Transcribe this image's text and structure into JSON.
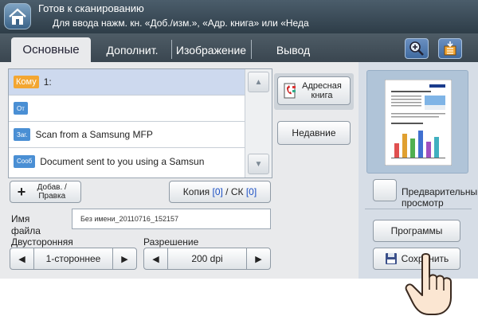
{
  "status": {
    "title": "Готов к сканированию",
    "message": "Для ввода нажм. кн. «Доб./изм.», «Адр. книга» или «Неда"
  },
  "tabs": [
    {
      "label": "Основные"
    },
    {
      "label": "Дополнит."
    },
    {
      "label": "Изображение"
    },
    {
      "label": "Вывод"
    }
  ],
  "address": {
    "rows": [
      {
        "tag": "Кому",
        "text": "1:"
      },
      {
        "tag": "От",
        "text": ""
      },
      {
        "tag": "Заг.",
        "text": "Scan from a Samsung MFP"
      },
      {
        "tag": "Сооб",
        "text": "Document sent to you using a Samsun"
      }
    ],
    "address_book": "Адресная книга",
    "recent": "Недавние"
  },
  "actions": {
    "add_edit": "Добав. / Правка",
    "copy_prefix": "Копия ",
    "copy_count": "[0]",
    "bcc_prefix": " / СК ",
    "bcc_count": "[0]"
  },
  "filename": {
    "label": "Имя файла",
    "value": "Без имени_20110716_152157"
  },
  "duplex": {
    "label": "Двусторонняя",
    "value": "1-стороннее"
  },
  "resolution": {
    "label": "Разрешение",
    "value": "200 dpi"
  },
  "preview": {
    "label": "Предварительный просмотр",
    "programs": "Программы",
    "save": "Сохранить"
  },
  "colors": {
    "accent": "#4a8fd4",
    "to_tag": "#f3a632",
    "count_blue": "#1a4fc4"
  }
}
